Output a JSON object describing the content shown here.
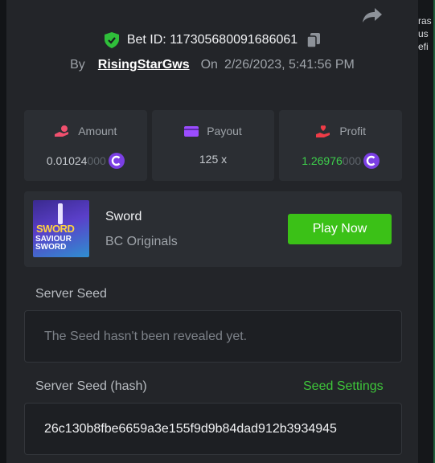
{
  "bet": {
    "prefix": "Bet ID:",
    "id": "117305680091686061",
    "by_label": "By",
    "username": "RisingStarGws",
    "on_label": "On",
    "datetime": "2/26/2023, 5:41:56 PM"
  },
  "stats": {
    "amount_label": "Amount",
    "amount_main": "0.01024",
    "amount_dim": "000",
    "payout_label": "Payout",
    "payout_value": "125 x",
    "profit_label": "Profit",
    "profit_main": "1.26976",
    "profit_dim": "000"
  },
  "game": {
    "name": "Sword",
    "provider": "BC Originals",
    "play_label": "Play Now",
    "thumb_line1": "SWORD",
    "thumb_line2": "SAVIOUR",
    "thumb_line3": "SWORD"
  },
  "server_seed": {
    "label": "Server Seed",
    "value": "The Seed hasn't been revealed yet."
  },
  "server_seed_hash": {
    "label": "Server Seed (hash)",
    "settings_label": "Seed Settings",
    "value": "26c130b8fbe6659a3e155f9d9b84dad912b3934945"
  },
  "background_peek": {
    "line1": "ras",
    "line2": "us",
    "line3": "efi"
  },
  "colors": {
    "modal_bg": "#232529",
    "card_bg": "#2b2e33",
    "accent_green": "#3bc117",
    "coin_purple": "#7b3fe4"
  },
  "icons": {
    "share": "share-arrow-icon",
    "verified": "shield-check-icon",
    "copy": "copy-icon",
    "amount": "coins-hand-icon",
    "payout": "wallet-card-icon",
    "profit": "hand-heart-icon",
    "currency": "bc-coin-icon"
  }
}
